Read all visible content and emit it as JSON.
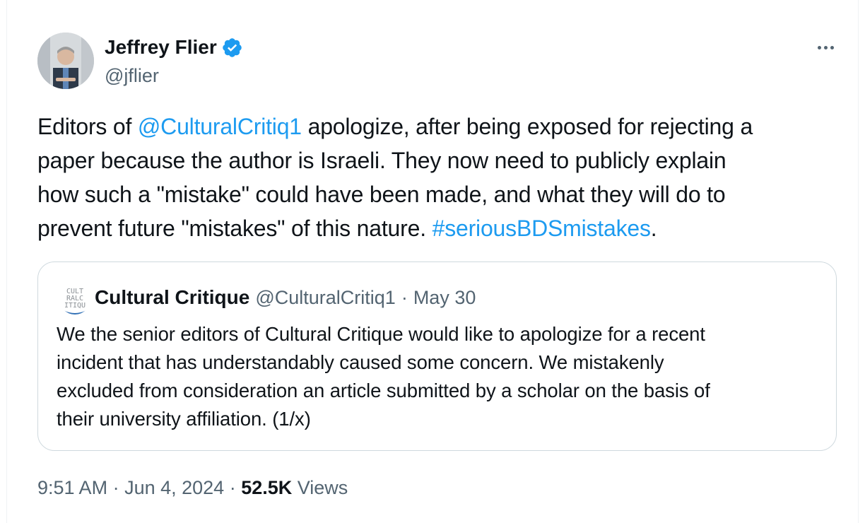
{
  "author": {
    "name": "Jeffrey Flier",
    "handle": "@jflier",
    "verified_color": "#1d9bf0"
  },
  "tweet": {
    "segments": [
      "Editors of ",
      "@CulturalCritiq1",
      " apologize, after being exposed for rejecting a",
      "paper because the author is Israeli. They now need to publicly explain",
      "how such a \"mistake\" could have been made, and what they will do to",
      "prevent future \"mistakes\" of this nature. ",
      "#seriousBDSmistakes",
      "."
    ]
  },
  "quote": {
    "avatar_text": [
      "CULT",
      "RALC",
      "ITIQU"
    ],
    "name": "Cultural Critique",
    "handle": "@CulturalCritiq1",
    "separator": "·",
    "date": "May 30",
    "lines": [
      "We the senior editors of Cultural Critique would like to apologize for a recent",
      "incident that has understandably caused some concern. We mistakenly",
      "excluded from consideration an article submitted by a scholar on the basis of",
      "their university affiliation. (1/x)"
    ]
  },
  "meta": {
    "time": "9:51 AM",
    "sep1": " · ",
    "date": "Jun 4, 2024",
    "sep2": " · ",
    "views_count": "52.5K",
    "views_label": " Views"
  },
  "colors": {
    "link": "#1d9bf0",
    "secondary_text": "#536471",
    "primary_text": "#0f1419",
    "border": "#cfd9de"
  },
  "icons": {
    "verified": "verified-badge-icon",
    "more": "more-options-icon"
  }
}
